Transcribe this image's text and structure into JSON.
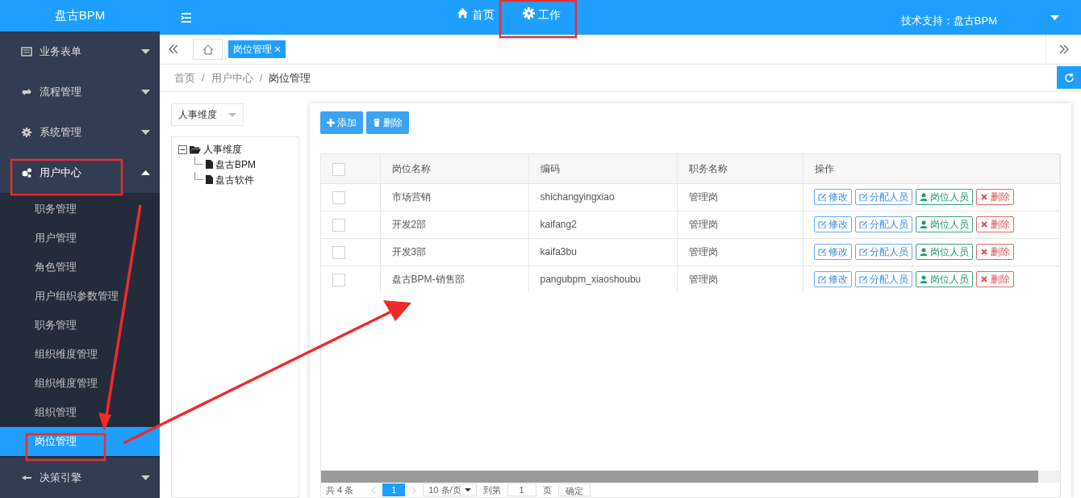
{
  "logo": "盘古BPM",
  "top_nav": [
    {
      "label": "首页"
    },
    {
      "label": "工作"
    }
  ],
  "support_text": "技术支持：盘古BPM",
  "sidebar": {
    "items": [
      {
        "label": "业务表单",
        "expanded": false
      },
      {
        "label": "流程管理",
        "expanded": false
      },
      {
        "label": "系统管理",
        "expanded": false
      },
      {
        "label": "用户中心",
        "expanded": true,
        "children": [
          {
            "label": "职务管理",
            "selected": false
          },
          {
            "label": "用户管理",
            "selected": false
          },
          {
            "label": "角色管理",
            "selected": false
          },
          {
            "label": "用户组织参数管理",
            "selected": false
          },
          {
            "label": "职务管理",
            "selected": false
          },
          {
            "label": "组织维度管理",
            "selected": false
          },
          {
            "label": "组织维度管理",
            "selected": false
          },
          {
            "label": "组织管理",
            "selected": false
          },
          {
            "label": "岗位管理",
            "selected": true
          }
        ]
      },
      {
        "label": "决策引擎",
        "expanded": false
      }
    ]
  },
  "tabs": [
    {
      "label": "岗位管理",
      "selected": true
    }
  ],
  "breadcrumb": [
    {
      "kind": "link",
      "text": "首页"
    },
    {
      "kind": "separator",
      "text": "/"
    },
    {
      "kind": "link",
      "text": "用户中心"
    },
    {
      "kind": "separator",
      "text": "/"
    },
    {
      "kind": "current",
      "text": "岗位管理"
    }
  ],
  "dimension_select": {
    "value": "人事维度"
  },
  "tree": [
    {
      "label": "人事维度",
      "expanded": true,
      "children": [
        {
          "label": "盘古BPM"
        },
        {
          "label": "盘古软件"
        }
      ]
    }
  ],
  "toolbar_buttons": [
    {
      "kind": "add",
      "label": "添加"
    },
    {
      "kind": "delete",
      "label": "删除"
    }
  ],
  "table": {
    "header_checked": false,
    "columns": [
      "岗位名称",
      "编码",
      "职务名称",
      "操作"
    ],
    "rows": [
      {
        "checked": false,
        "cells": [
          "市场营销",
          "shichangyingxiao",
          "管理岗"
        ],
        "actions": [
          {
            "kind": "edit",
            "label": "修改"
          },
          {
            "kind": "assign",
            "label": "分配人员"
          },
          {
            "kind": "members",
            "label": "岗位人员"
          },
          {
            "kind": "delete",
            "label": "删除"
          }
        ]
      },
      {
        "checked": false,
        "cells": [
          "开发2部",
          "kaifang2",
          "管理岗"
        ],
        "actions": [
          {
            "kind": "edit",
            "label": "修改"
          },
          {
            "kind": "assign",
            "label": "分配人员"
          },
          {
            "kind": "members",
            "label": "岗位人员"
          },
          {
            "kind": "delete",
            "label": "删除"
          }
        ]
      },
      {
        "checked": false,
        "cells": [
          "开发3部",
          "kaifa3bu",
          "管理岗"
        ],
        "actions": [
          {
            "kind": "edit",
            "label": "修改"
          },
          {
            "kind": "assign",
            "label": "分配人员"
          },
          {
            "kind": "members",
            "label": "岗位人员"
          },
          {
            "kind": "delete",
            "label": "删除"
          }
        ]
      },
      {
        "checked": false,
        "cells": [
          "盘古BPM-销售部",
          "pangubpm_xiaoshoubu",
          "管理岗"
        ],
        "actions": [
          {
            "kind": "edit",
            "label": "修改"
          },
          {
            "kind": "assign",
            "label": "分配人员"
          },
          {
            "kind": "members",
            "label": "岗位人员"
          },
          {
            "kind": "delete",
            "label": "删除"
          }
        ]
      }
    ]
  },
  "pagination": {
    "total": "共 4 条",
    "pages": [
      {
        "label": "1",
        "selected": true
      }
    ],
    "page_size": "10 条/页",
    "goto_label": "到第",
    "goto_value": "1",
    "page_suffix": "页",
    "confirm": "确定"
  }
}
